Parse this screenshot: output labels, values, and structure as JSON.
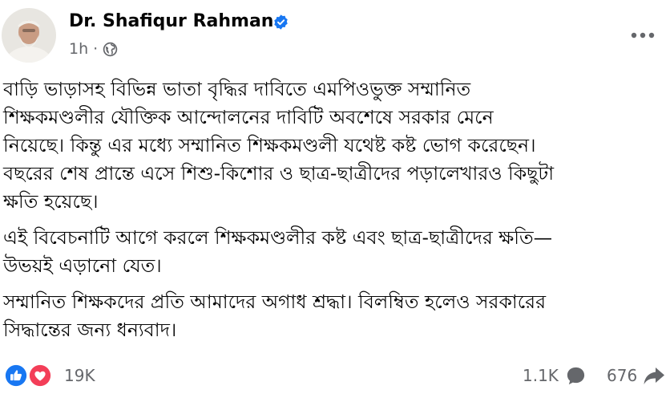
{
  "post": {
    "author": "Dr. Shafiqur Rahman",
    "timestamp": "1h",
    "separator": "·",
    "paragraphs": [
      "বাড়ি ভাড়াসহ বিভিন্ন ভাতা বৃদ্ধির দাবিতে এমপিওভুক্ত সম্মানিত\nশিক্ষকমণ্ডলীর যৌক্তিক আন্দোলনের দাবিটি অবশেষে সরকার মেনে\nনিয়েছে। কিন্তু এর মধ্যে সম্মানিত শিক্ষকমণ্ডলী যথেষ্ট কষ্ট ভোগ করেছেন।\nবছরের শেষ প্রান্তে এসে শিশু-কিশোর ও ছাত্র-ছাত্রীদের পড়ালেখারও কিছুটা\nক্ষতি হয়েছে।",
      "এই বিবেচনাটি আগে করলে শিক্ষকমণ্ডলীর কষ্ট এবং ছাত্র-ছাত্রীদের ক্ষতি—\nউভয়ই এড়ানো যেত।",
      "সম্মানিত শিক্ষকদের প্রতি আমাদের অগাধ শ্রদ্ধা। বিলম্বিত হলেও সরকারের\nসিদ্ধান্তের জন্য ধন্যবাদ।"
    ]
  },
  "footer": {
    "reactions_count": "19K",
    "comments_count": "1.1K",
    "shares_count": "676"
  },
  "icons": {
    "verified": "verified-badge-icon",
    "audience": "globe-icon",
    "more": "more-horizontal-icon",
    "like": "like-icon",
    "love": "love-icon",
    "comment": "comment-icon",
    "share": "share-icon"
  },
  "colors": {
    "brand_blue": "#1877f2",
    "love_red": "#f33e58",
    "secondary_text": "#65676b",
    "primary_text": "#050505"
  }
}
